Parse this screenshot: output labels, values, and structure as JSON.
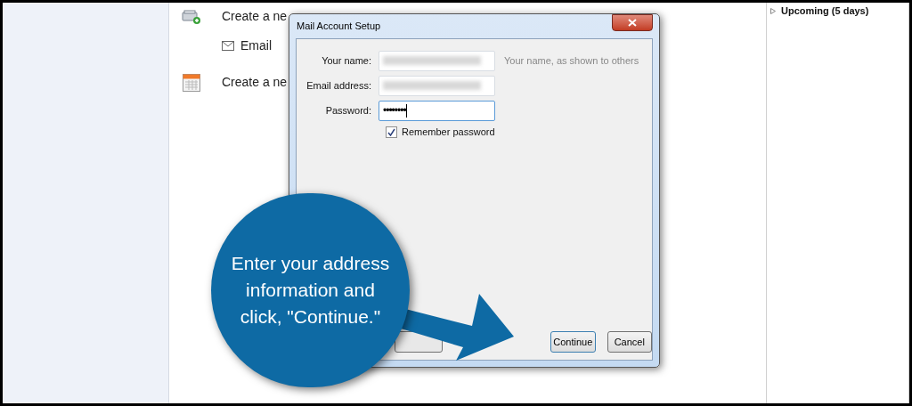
{
  "main": {
    "items": [
      {
        "kind": "address-book",
        "label": "Create a ne"
      },
      {
        "kind": "mail",
        "label": "Email"
      },
      {
        "kind": "calendar",
        "label": "Create a ne"
      }
    ]
  },
  "sidebar": {
    "section": {
      "label": "Upcoming (5 days)",
      "expanded": false
    }
  },
  "dialog": {
    "title": "Mail Account Setup",
    "fields": [
      {
        "label": "Your name:",
        "hint": "Your name, as shown to others",
        "focused": false
      },
      {
        "label": "Email address:",
        "focused": false
      },
      {
        "label": "Password:",
        "focused": true,
        "value": "••••••••"
      }
    ],
    "remember": {
      "label": "Remember password",
      "checked": true
    },
    "buttons": [
      {
        "label": "Continue",
        "default": true
      },
      {
        "label": "Cancel",
        "default": false
      }
    ]
  },
  "callout": {
    "text": "Enter your address information and click, \"Continue.\""
  }
}
